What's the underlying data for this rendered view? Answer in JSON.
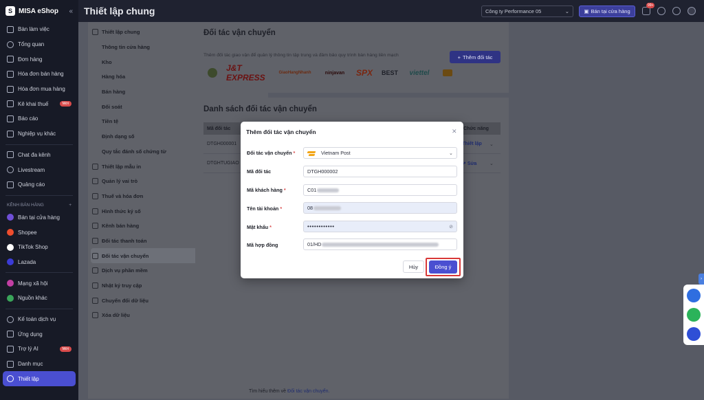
{
  "app": {
    "brand": "MISA eShop"
  },
  "sidebar": {
    "items": [
      {
        "label": "Bàn làm việc"
      },
      {
        "label": "Tổng quan"
      },
      {
        "label": "Đơn hàng"
      },
      {
        "label": "Hóa đơn bán hàng"
      },
      {
        "label": "Hóa đơn mua hàng"
      },
      {
        "label": "Kê khai thuế",
        "badge": "Mới"
      },
      {
        "label": "Báo cáo"
      },
      {
        "label": "Nghiệp vụ khác"
      },
      {
        "label": "Chat đa kênh"
      },
      {
        "label": "Livestream"
      },
      {
        "label": "Quảng cáo"
      }
    ],
    "sales_channel_title": "KÊNH BÁN HÀNG",
    "channels": [
      {
        "label": "Bán tại cửa hàng",
        "color": "#6f4fd6"
      },
      {
        "label": "Shopee",
        "color": "#ee4d2d"
      },
      {
        "label": "TikTok Shop",
        "color": "#ffffff"
      },
      {
        "label": "Lazada",
        "color": "#3b3bd6"
      }
    ],
    "social": [
      {
        "label": "Mạng xã hội",
        "color": "#c23fa3"
      },
      {
        "label": "Nguồn khác",
        "color": "#3aa55a"
      }
    ],
    "bottom": [
      {
        "label": "Kế toán dịch vụ"
      },
      {
        "label": "Ứng dụng"
      },
      {
        "label": "Trợ lý AI",
        "badge": "Mới"
      },
      {
        "label": "Danh mục"
      },
      {
        "label": "Thiết lập"
      }
    ]
  },
  "header": {
    "title": "Thiết lập chung",
    "company": "Công ty Performance 05",
    "store_button": "Bán tại cửa hàng",
    "notif_count": "99+"
  },
  "settings_menu": {
    "general": "Thiết lập chung",
    "sub": [
      "Thông tin cửa hàng",
      "Kho",
      "Hàng hóa",
      "Bán hàng",
      "Đối soát",
      "Tiền tệ",
      "Định dạng số",
      "Quy tắc đánh số chứng từ"
    ],
    "others": [
      "Thiết lập mẫu in",
      "Quản lý vai trò",
      "Thuế và hóa đơn",
      "Hình thức ký số",
      "Kênh bán hàng",
      "Đối tác thanh toán",
      "Đối tác vận chuyển",
      "Dịch vụ phần mềm",
      "Nhật ký truy cập",
      "Chuyển đổi dữ liệu",
      "Xóa dữ liệu"
    ]
  },
  "partners_card": {
    "title": "Đối tác vận chuyển",
    "description": "Thêm đối tác giao vận để quản lý thông tin tập trung và đảm bảo quy trình bàn hàng liền mạch",
    "add_button": "Thêm đối tác",
    "logos": [
      "J&T EXPRESS",
      "GiaoHangNhanh",
      "ninjavan",
      "SPX",
      "BEST",
      "viettel"
    ]
  },
  "list_card": {
    "title": "Danh sách đối tác vận chuyển",
    "col_code": "Mã đối tác",
    "col_action": "Chức năng",
    "rows": [
      {
        "code": "DTGH000001",
        "action": "Thiết lập"
      },
      {
        "code": "DTGHTUGIAO",
        "action": "Sửa"
      }
    ]
  },
  "footer": {
    "text": "Tìm hiểu thêm về",
    "link": "Đối tác vận chuyển."
  },
  "modal": {
    "title": "Thêm đối tác vận chuyển",
    "partner_label": "Đối tác vận chuyển",
    "partner_value": "Vietnam Post",
    "code_label": "Mã đối tác",
    "code_value": "DTGH000002",
    "customer_label": "Mã khách hàng",
    "customer_value": "C01",
    "account_label": "Tên tài khoản",
    "account_value": "08",
    "password_label": "Mật khẩu",
    "password_value": "••••••••••••",
    "contract_label": "Mã hợp đồng",
    "contract_value": "01/HD",
    "cancel": "Hủy",
    "confirm": "Đồng ý"
  },
  "colors": {
    "accent": "#4a4fd1",
    "highlight": "#d83838",
    "sidebar_bg": "#171a26"
  }
}
